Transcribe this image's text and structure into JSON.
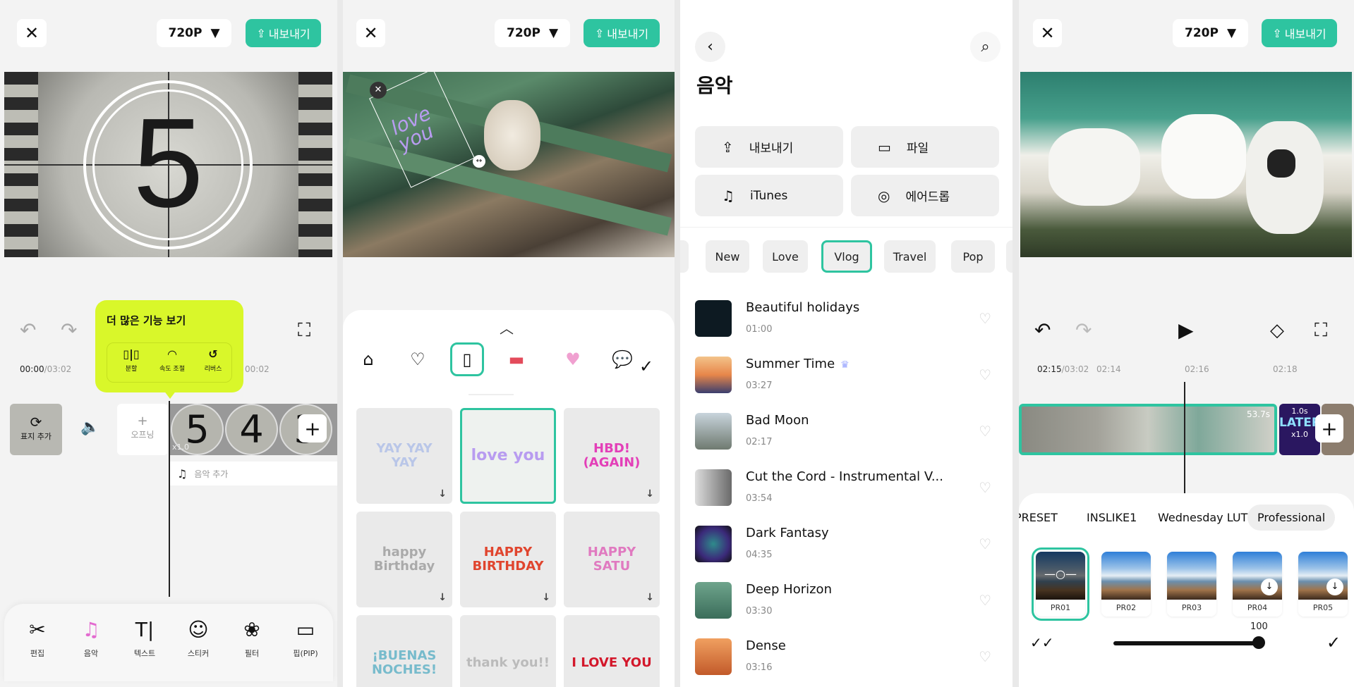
{
  "colors": {
    "accent": "#2ec4a0",
    "tooltip": "#d9f72a"
  },
  "panel1": {
    "resolution": "720P",
    "export_label": "내보내기",
    "countdown_number": "5",
    "tooltip": {
      "title": "더 많은 기능 보기",
      "items": [
        {
          "icon": "split-icon",
          "label": "분할"
        },
        {
          "icon": "speed-icon",
          "label": "속도 조절"
        },
        {
          "icon": "reverse-icon",
          "label": "리버스"
        }
      ]
    },
    "time_current": "00:00",
    "time_total": "/03:02",
    "tick": "00:02",
    "cover_label": "표지 추가",
    "opening_label": "오프닝",
    "clip_speed": "x1.0",
    "clip_frames": [
      "5",
      "4",
      "3"
    ],
    "add_music_label": "음악 추가",
    "tools": [
      {
        "icon": "edit-icon",
        "label": "편집"
      },
      {
        "icon": "music-icon",
        "label": "음악"
      },
      {
        "icon": "text-icon",
        "label": "텍스트"
      },
      {
        "icon": "sticker-icon",
        "label": "스티커"
      },
      {
        "icon": "filter-icon",
        "label": "필터"
      },
      {
        "icon": "pip-icon",
        "label": "핍(PIP)"
      }
    ]
  },
  "panel2": {
    "resolution": "720P",
    "export_label": "내보내기",
    "sticker_overlay": "love you",
    "categories": [
      "store-icon",
      "favorite-heart-icon",
      "text-sticker-icon",
      "banner-sticker-icon",
      "heart-wings-icon",
      "speech-heart-icon"
    ],
    "stickers": [
      "YAY YAY YAY",
      "love you",
      "HBD! (AGAIN)",
      "happy Birthday",
      "HAPPY BIRTHDAY",
      "HAPPY SATU",
      "¡BUENAS NOCHES!",
      "thank you!!",
      "I LOVE YOU"
    ]
  },
  "panel3": {
    "title": "음악",
    "sources": [
      {
        "icon": "export-icon",
        "label": "내보내기"
      },
      {
        "icon": "folder-icon",
        "label": "파일"
      },
      {
        "icon": "itunes-note-icon",
        "label": "iTunes"
      },
      {
        "icon": "airdrop-icon",
        "label": "에어드롭"
      }
    ],
    "genres": [
      "New",
      "Love",
      "Vlog",
      "Travel",
      "Pop"
    ],
    "selected_genre": "Vlog",
    "songs": [
      {
        "name": "Beautiful holidays",
        "duration": "01:00"
      },
      {
        "name": "Summer Time",
        "duration": "03:27",
        "badge": "crown-icon"
      },
      {
        "name": "Bad Moon",
        "duration": "02:17"
      },
      {
        "name": "Cut the Cord - Instrumental V...",
        "duration": "03:54"
      },
      {
        "name": "Dark Fantasy",
        "duration": "04:35"
      },
      {
        "name": "Deep Horizon",
        "duration": "03:30"
      },
      {
        "name": "Dense",
        "duration": "03:16"
      }
    ]
  },
  "panel4": {
    "resolution": "720P",
    "export_label": "내보내기",
    "time_current": "02:15",
    "time_total": "/03:02",
    "ticks": [
      "02:14",
      "02:16",
      "02:18"
    ],
    "clip_duration": "53.7s",
    "clip2_duration": "1.0s",
    "clip2_text": "LATER",
    "clip_speed": "x1.0",
    "filter_tabs": [
      "PRESET",
      "INSLIKE1",
      "Wednesday LUT",
      "Professional"
    ],
    "selected_tab": "Professional",
    "filters": [
      "PR01",
      "PR02",
      "PR03",
      "PR04",
      "PR05"
    ],
    "selected_filter": "PR01",
    "intensity": 100
  }
}
